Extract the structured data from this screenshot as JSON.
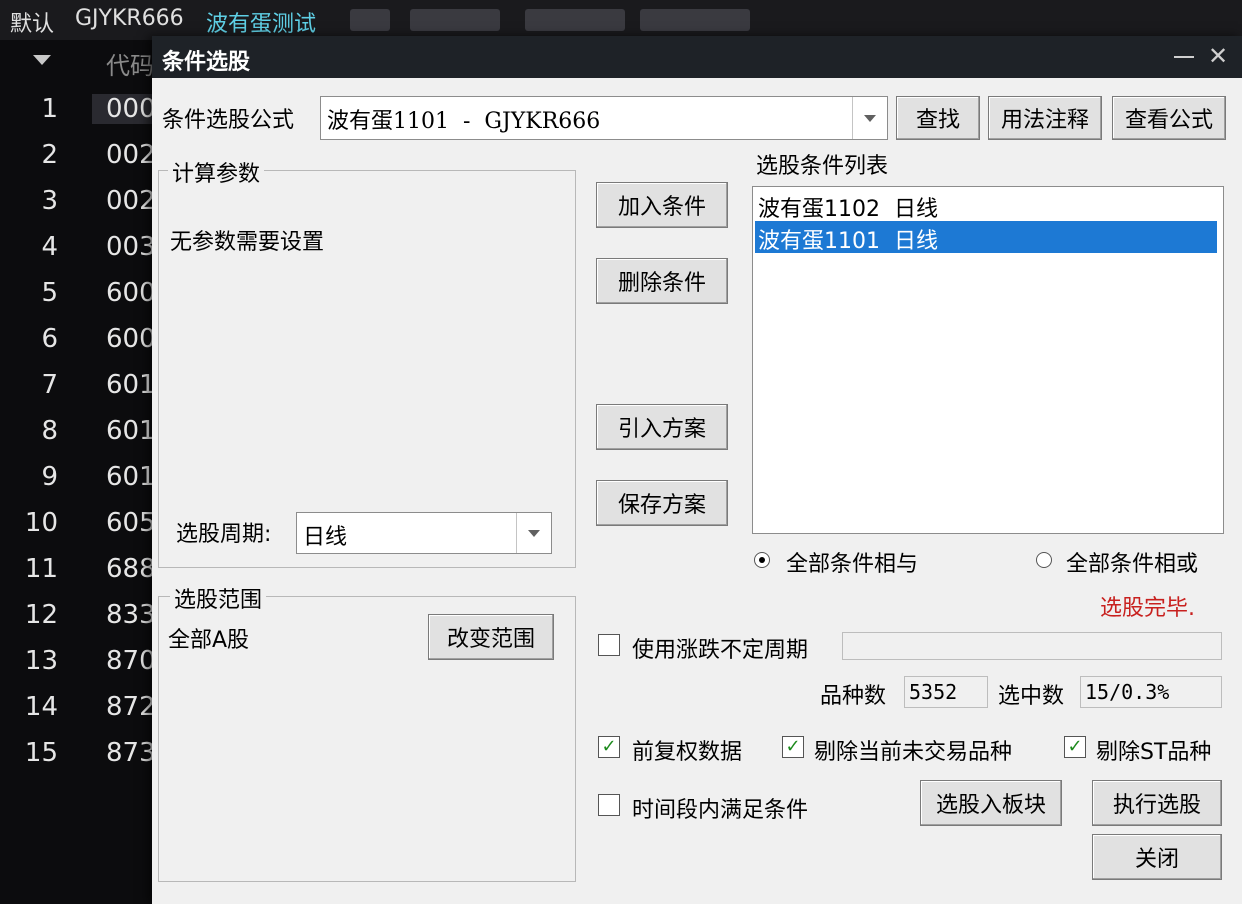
{
  "app": {
    "tabs": [
      "默认",
      "GJYKR666",
      "波有蛋测试"
    ],
    "column_header": "代码",
    "rows": [
      {
        "idx": "1",
        "code": "000"
      },
      {
        "idx": "2",
        "code": "002"
      },
      {
        "idx": "3",
        "code": "002"
      },
      {
        "idx": "4",
        "code": "003"
      },
      {
        "idx": "5",
        "code": "600"
      },
      {
        "idx": "6",
        "code": "600"
      },
      {
        "idx": "7",
        "code": "601"
      },
      {
        "idx": "8",
        "code": "601"
      },
      {
        "idx": "9",
        "code": "601"
      },
      {
        "idx": "10",
        "code": "605"
      },
      {
        "idx": "11",
        "code": "688"
      },
      {
        "idx": "12",
        "code": "833"
      },
      {
        "idx": "13",
        "code": "870"
      },
      {
        "idx": "14",
        "code": "872"
      },
      {
        "idx": "15",
        "code": "873"
      }
    ]
  },
  "dialog": {
    "title": "条件选股",
    "close_symbol": "✕",
    "formula_label": "条件选股公式",
    "formula_value": "波有蛋1101  -  GJYKR666",
    "find_button": "查找",
    "usage_button": "用法注释",
    "view_formula_button": "查看公式",
    "params_group": "计算参数",
    "params_text": "无参数需要设置",
    "period_label": "选股周期:",
    "period_value": "日线",
    "range_group": "选股范围",
    "range_value": "全部A股",
    "change_range_button": "改变范围",
    "add_condition_button": "加入条件",
    "delete_condition_button": "删除条件",
    "import_plan_button": "引入方案",
    "save_plan_button": "保存方案",
    "conditions_list_label": "选股条件列表",
    "conditions": [
      {
        "text": "波有蛋1102  日线",
        "selected": false
      },
      {
        "text": "波有蛋1101  日线",
        "selected": true
      }
    ],
    "radio_and": "全部条件相与",
    "radio_or": "全部条件相或",
    "radio_selected": "and",
    "status_text": "选股完毕.",
    "use_uncertain_period": "使用涨跌不定周期",
    "varieties_label": "品种数",
    "varieties_value": "5352",
    "selected_label": "选中数",
    "selected_value": "15/0.3%",
    "pre_adjust": "前复权数据",
    "exclude_untraded": "剔除当前未交易品种",
    "exclude_st": "剔除ST品种",
    "time_range_condition": "时间段内满足条件",
    "to_block_button": "选股入板块",
    "execute_button": "执行选股",
    "close_button": "关闭",
    "checks": {
      "use_uncertain_period": false,
      "pre_adjust": true,
      "exclude_untraded": true,
      "exclude_st": true,
      "time_range_condition": false
    },
    "check_mark": "✓"
  }
}
